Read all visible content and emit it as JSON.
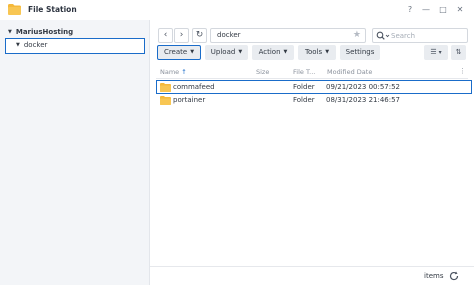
{
  "window": {
    "title": "File Station",
    "help_glyph": "?",
    "minimize_glyph": "—",
    "maximize_glyph": "□",
    "close_glyph": "✕"
  },
  "sidebar": {
    "root_label": "MariusHosting",
    "items": [
      {
        "label": "docker",
        "selected": true
      }
    ]
  },
  "navigation": {
    "back_glyph": "‹",
    "forward_glyph": "›",
    "refresh_glyph": "↻",
    "path": "docker",
    "star_glyph": "★"
  },
  "search": {
    "placeholder": "Search",
    "value": ""
  },
  "toolbar": {
    "buttons": [
      {
        "label": "Create",
        "active": true
      },
      {
        "label": "Upload",
        "active": false
      },
      {
        "label": "Action",
        "active": false
      },
      {
        "label": "Tools",
        "active": false
      },
      {
        "label": "Settings",
        "active": false
      }
    ],
    "dropdown_glyph": "▼",
    "view_list_glyph": "☰",
    "view_options_glyph": "▾",
    "sort_glyph": "⇅"
  },
  "table": {
    "columns": [
      "Name",
      "Size",
      "File T...",
      "Modified Date"
    ],
    "sort_arrow": "↑",
    "column_menu_glyph": "⋮",
    "rows": [
      {
        "name": "commafeed",
        "size": "",
        "type": "Folder",
        "modified": "09/21/2023 00:57:52",
        "selected": true
      },
      {
        "name": "portainer",
        "size": "",
        "type": "Folder",
        "modified": "08/31/2023 21:46:57",
        "selected": false
      }
    ]
  },
  "footer": {
    "items_label": "items"
  },
  "colors": {
    "accent": "#1a6cc9",
    "folder": "#f5b93b"
  },
  "icons": {
    "app": "folder-icon",
    "search": "search-icon",
    "refresh": "refresh-icon",
    "row": "folder-icon"
  }
}
